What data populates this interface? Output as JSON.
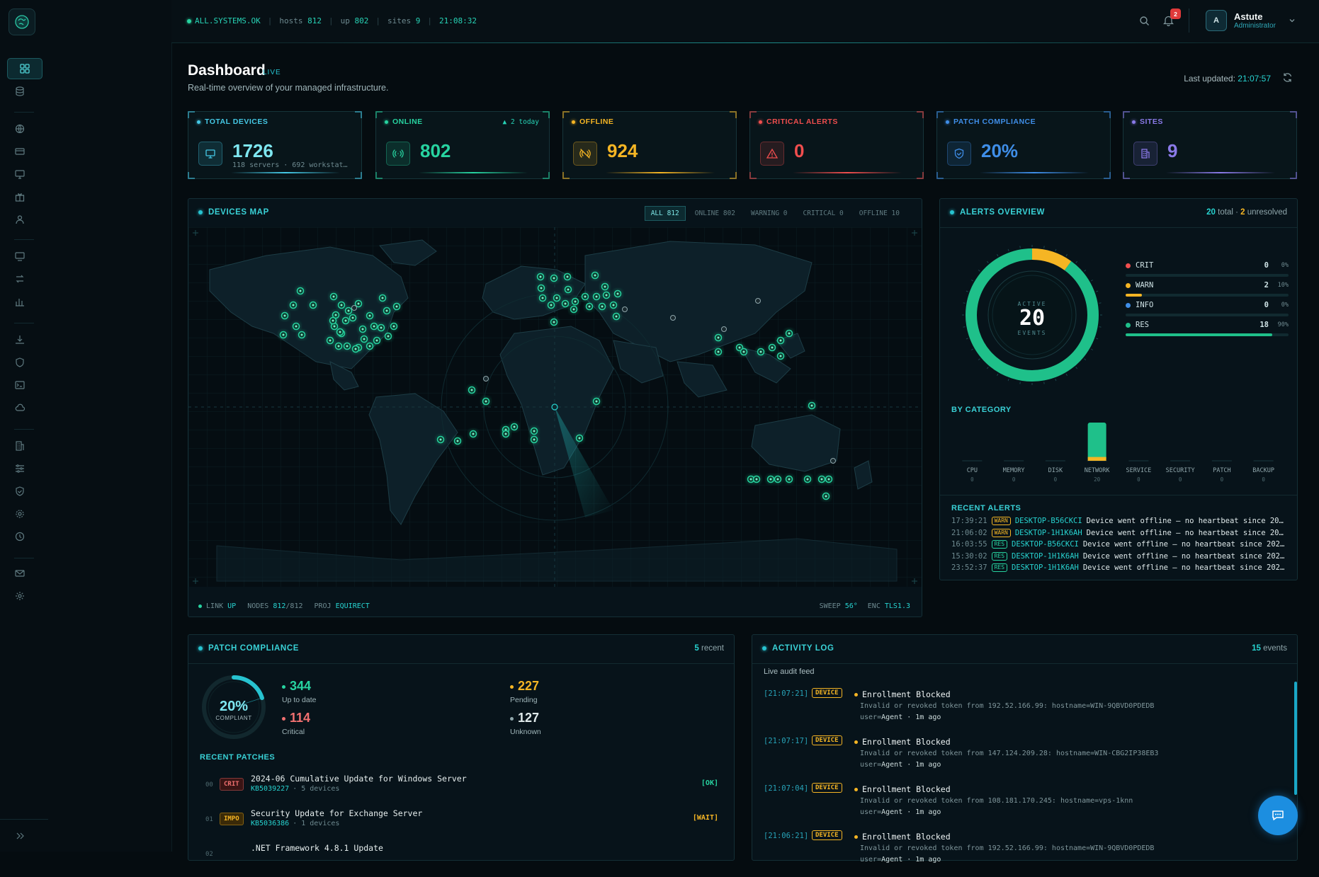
{
  "topbar": {
    "status": "ALL.SYSTEMS.OK",
    "hosts_label": "hosts",
    "hosts_value": "812",
    "up_label": "up",
    "up_value": "802",
    "sites_label": "sites",
    "sites_value": "9",
    "clock": "21:08:32",
    "notification_count": "2",
    "user_initial": "A",
    "user_name": "Astute",
    "user_role": "Administrator"
  },
  "header": {
    "title": "Dashboard",
    "live_tag": "LIVE",
    "subtitle": "Real-time overview of your managed infrastructure.",
    "last_updated_label": "Last updated:",
    "last_updated_time": "21:07:57"
  },
  "kpis": [
    {
      "label": "TOTAL DEVICES",
      "value": "1726",
      "sub": "118 servers · 692 workstat…",
      "color": "#45c9e6",
      "icon": "monitor-icon"
    },
    {
      "label": "ONLINE",
      "value": "802",
      "trend": "▲ 2 today",
      "color": "#27d3a0",
      "icon": "signal-icon"
    },
    {
      "label": "OFFLINE",
      "value": "924",
      "color": "#f5b524",
      "icon": "signal-off-icon"
    },
    {
      "label": "CRITICAL ALERTS",
      "value": "0",
      "color": "#f04e4e",
      "icon": "warning-icon"
    },
    {
      "label": "PATCH COMPLIANCE",
      "value": "20%",
      "color": "#3f8ee8",
      "icon": "shield-icon"
    },
    {
      "label": "SITES",
      "value": "9",
      "color": "#8a7ae8",
      "icon": "building-icon"
    }
  ],
  "map": {
    "title": "DEVICES MAP",
    "tabs": [
      {
        "label": "ALL",
        "count": "812"
      },
      {
        "label": "ONLINE",
        "count": "802"
      },
      {
        "label": "WARNING",
        "count": "0"
      },
      {
        "label": "CRITICAL",
        "count": "0"
      },
      {
        "label": "OFFLINE",
        "count": "10"
      }
    ],
    "footer": {
      "link_label": "LINK",
      "link_value": "UP",
      "nodes_label": "NODES",
      "nodes_value": "812",
      "nodes_total": "/812",
      "proj_label": "PROJ",
      "proj_value": "EQUIRECT",
      "sweep_label": "SWEEP",
      "sweep_value": "56°",
      "enc_label": "ENC",
      "enc_value": "TLS1.3"
    }
  },
  "alerts": {
    "title": "ALERTS OVERVIEW",
    "total": "20",
    "total_label": "total ·",
    "unresolved": "2",
    "unresolved_label": "unresolved",
    "donut_top": "ACTIVE",
    "donut_value": "20",
    "donut_bottom": "EVENTS",
    "legend": [
      {
        "name": "CRIT",
        "count": "0",
        "pct": "0%",
        "frac": 0,
        "color": "#f04e4e"
      },
      {
        "name": "WARN",
        "count": "2",
        "pct": "10%",
        "frac": 0.1,
        "color": "#f5b524"
      },
      {
        "name": "INFO",
        "count": "0",
        "pct": "0%",
        "frac": 0,
        "color": "#3f8ee8"
      },
      {
        "name": "RES",
        "count": "18",
        "pct": "90%",
        "frac": 0.9,
        "color": "#1fc08a"
      }
    ],
    "by_category_title": "BY CATEGORY",
    "categories": [
      {
        "name": "CPU",
        "count": "0"
      },
      {
        "name": "MEMORY",
        "count": "0"
      },
      {
        "name": "DISK",
        "count": "0"
      },
      {
        "name": "NETWORK",
        "count": "20"
      },
      {
        "name": "SERVICE",
        "count": "0"
      },
      {
        "name": "SECURITY",
        "count": "0"
      },
      {
        "name": "PATCH",
        "count": "0"
      },
      {
        "name": "BACKUP",
        "count": "0"
      }
    ],
    "recent_title": "RECENT ALERTS",
    "recent": [
      {
        "time": "17:39:21",
        "tag": "WARN",
        "host": "DESKTOP-B56CKCI",
        "msg": "Device went offline — no heartbeat since 202…"
      },
      {
        "time": "21:06:02",
        "tag": "WARN",
        "host": "DESKTOP-1H1K6AH",
        "msg": "Device went offline — no heartbeat since 202…"
      },
      {
        "time": "16:03:55",
        "tag": "RES",
        "host": "DESKTOP-B56CKCI",
        "msg": "Device went offline — no heartbeat since 2026…"
      },
      {
        "time": "15:30:02",
        "tag": "RES",
        "host": "DESKTOP-1H1K6AH",
        "msg": "Device went offline — no heartbeat since 2026…"
      },
      {
        "time": "23:52:37",
        "tag": "RES",
        "host": "DESKTOP-1H1K6AH",
        "msg": "Device went offline — no heartbeat since 2026…"
      }
    ]
  },
  "patch": {
    "title": "PATCH COMPLIANCE",
    "recent_count": "5",
    "recent_label": "recent",
    "gauge_value": "20%",
    "gauge_label": "COMPLIANT",
    "gauge_frac": 0.2,
    "stats": [
      {
        "value": "344",
        "label": "Up to date",
        "color": "#27d3a0"
      },
      {
        "value": "227",
        "label": "Pending",
        "color": "#f5b524"
      },
      {
        "value": "114",
        "label": "Critical",
        "color": "#f07070"
      },
      {
        "value": "127",
        "label": "Unknown",
        "color": "#dfe9ea"
      }
    ],
    "recent_title": "RECENT PATCHES",
    "patches": [
      {
        "idx": "00",
        "badge": "CRIT",
        "name": "2024-06 Cumulative Update for Windows Server",
        "kb": "KB5039227",
        "devices": "· 5 devices",
        "status": "[OK]"
      },
      {
        "idx": "01",
        "badge": "IMPO",
        "name": "Security Update for Exchange Server",
        "kb": "KB5036386",
        "devices": "· 1 devices",
        "status": "[WAIT]"
      },
      {
        "idx": "02",
        "badge": "",
        "name": ".NET Framework 4.8.1 Update",
        "kb": "",
        "devices": "",
        "status": ""
      }
    ]
  },
  "activity": {
    "title": "ACTIVITY LOG",
    "count": "15",
    "count_label": "events",
    "feed_label": "Live audit feed",
    "events": [
      {
        "time": "[21:07:21]",
        "tag": "DEVICE",
        "title": "Enrollment Blocked",
        "desc": "Invalid or revoked token from 192.52.166.99: hostname=WIN-9QBVD0PDEDB",
        "user_label": "user=",
        "user": "Agent",
        "ago": "· 1m ago"
      },
      {
        "time": "[21:07:17]",
        "tag": "DEVICE",
        "title": "Enrollment Blocked",
        "desc": "Invalid or revoked token from 147.124.209.28: hostname=WIN-CBG2IP38EB3",
        "user_label": "user=",
        "user": "Agent",
        "ago": "· 1m ago"
      },
      {
        "time": "[21:07:04]",
        "tag": "DEVICE",
        "title": "Enrollment Blocked",
        "desc": "Invalid or revoked token from 108.181.170.245: hostname=vps-1knn",
        "user_label": "user=",
        "user": "Agent",
        "ago": "· 1m ago"
      },
      {
        "time": "[21:06:21]",
        "tag": "DEVICE",
        "title": "Enrollment Blocked",
        "desc": "Invalid or revoked token from 192.52.166.99: hostname=WIN-9QBVD0PDEDB",
        "user_label": "user=",
        "user": "Agent",
        "ago": "· 1m ago"
      }
    ]
  }
}
